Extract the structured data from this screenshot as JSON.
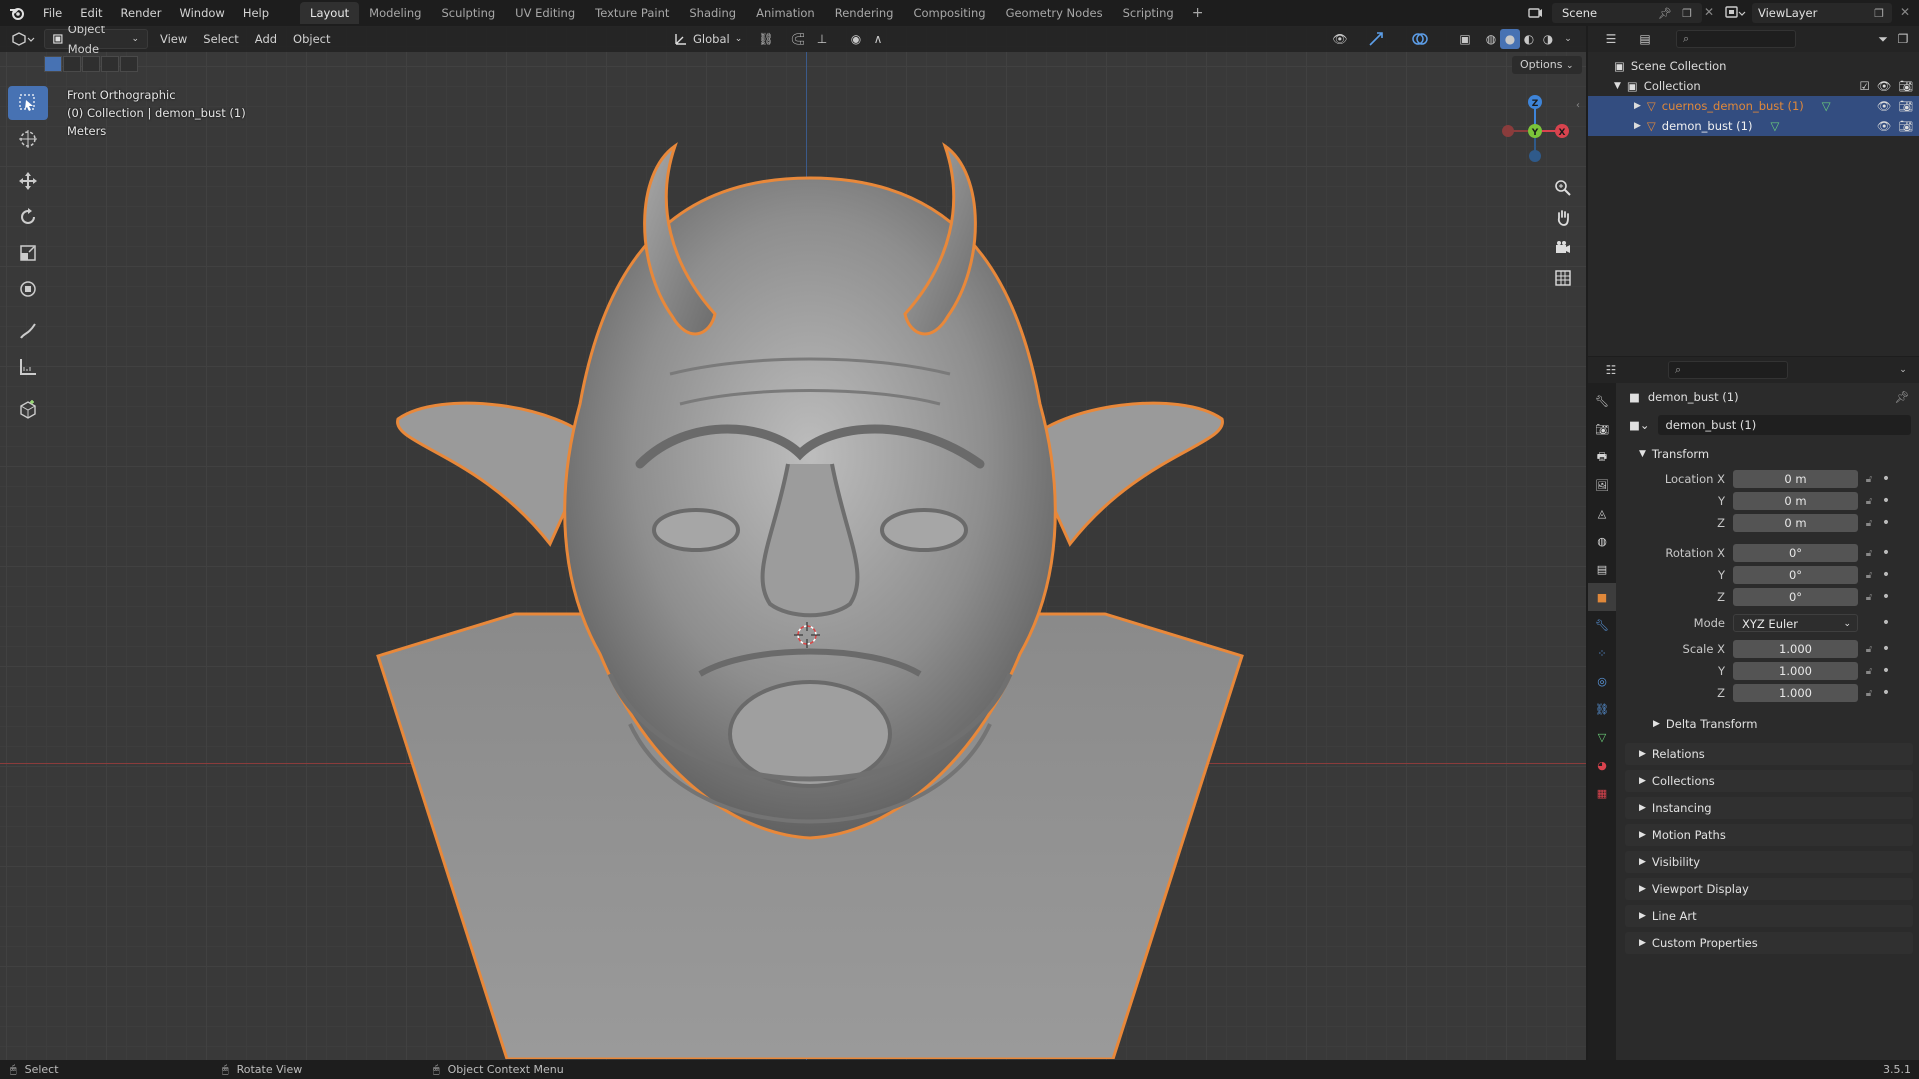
{
  "topbar": {
    "menus": [
      "File",
      "Edit",
      "Render",
      "Window",
      "Help"
    ],
    "workspaces": [
      "Layout",
      "Modeling",
      "Sculpting",
      "UV Editing",
      "Texture Paint",
      "Shading",
      "Animation",
      "Rendering",
      "Compositing",
      "Geometry Nodes",
      "Scripting"
    ],
    "active_workspace": "Layout",
    "scene": "Scene",
    "view_layer": "ViewLayer"
  },
  "viewport": {
    "mode": "Object Mode",
    "menus": [
      "View",
      "Select",
      "Add",
      "Object"
    ],
    "transform_orientation": "Global",
    "options_label": "Options",
    "info": {
      "view_name": "Front Orthographic",
      "collection_line": "(0) Collection | demon_bust (1)",
      "units": "Meters"
    },
    "gizmo_axes": {
      "z": "Z",
      "y": "Y",
      "x": "X"
    }
  },
  "outliner": {
    "root": "Scene Collection",
    "collection": "Collection",
    "objects": [
      {
        "name": "cuernos_demon_bust (1)",
        "color": "#e0883a"
      },
      {
        "name": "demon_bust (1)",
        "color": "#e8e8e8"
      }
    ]
  },
  "properties": {
    "object_name": "demon_bust (1)",
    "data_name": "demon_bust (1)",
    "transform_label": "Transform",
    "location": {
      "label": "Location X",
      "x": "0 m",
      "y": "0 m",
      "z": "0 m"
    },
    "rotation": {
      "label": "Rotation X",
      "x": "0°",
      "y": "0°",
      "z": "0°"
    },
    "mode": {
      "label": "Mode",
      "value": "XYZ Euler"
    },
    "scale": {
      "label": "Scale X",
      "x": "1.000",
      "y": "1.000",
      "z": "1.000"
    },
    "axis_labels": {
      "y": "Y",
      "z": "Z"
    },
    "delta_transform": "Delta Transform",
    "panels": [
      "Relations",
      "Collections",
      "Instancing",
      "Motion Paths",
      "Visibility",
      "Viewport Display",
      "Line Art",
      "Custom Properties"
    ]
  },
  "statusbar": {
    "select": "Select",
    "rotate": "Rotate View",
    "context": "Object Context Menu",
    "version": "3.5.1"
  },
  "colors": {
    "accent": "#4772b3",
    "selection_outline": "#e8883a",
    "x_axis": "#d9434e",
    "y_axis": "#7bc43a",
    "z_axis": "#3e84d8"
  }
}
